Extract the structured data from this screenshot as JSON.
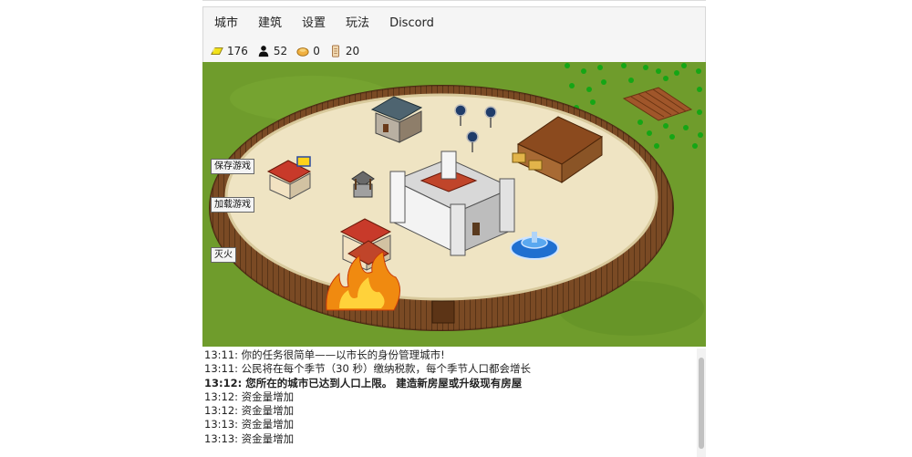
{
  "menu": [
    {
      "label": "城市"
    },
    {
      "label": "建筑"
    },
    {
      "label": "设置"
    },
    {
      "label": "玩法"
    },
    {
      "label": "Discord"
    }
  ],
  "resources": [
    {
      "icon": "gold-icon",
      "value": "176"
    },
    {
      "icon": "population-icon",
      "value": "52"
    },
    {
      "icon": "food-icon",
      "value": "0"
    },
    {
      "icon": "scroll-icon",
      "value": "20"
    }
  ],
  "side_buttons": {
    "save": "保存游戏",
    "load": "加载游戏",
    "extinguish": "灭火"
  },
  "log": [
    {
      "time": "13:11:",
      "text": "你的任务很简单——以市长的身份管理城市!",
      "bold": false
    },
    {
      "time": "13:11:",
      "text": "公民将在每个季节（30 秒）缴纳税款，每个季节人口都会增长",
      "bold": false
    },
    {
      "time": "13:12:",
      "text": " 您所在的城市已达到人口上限。 建造新房屋或升级现有房屋",
      "bold": true
    },
    {
      "time": "13:12:",
      "text": "资金量增加",
      "bold": false
    },
    {
      "time": "13:12:",
      "text": "资金量增加",
      "bold": false
    },
    {
      "time": "13:13:",
      "text": "资金量增加",
      "bold": false
    },
    {
      "time": "13:13:",
      "text": "资金量增加",
      "bold": false
    }
  ],
  "colors": {
    "grass": "#6b9a2a",
    "sand": "#eee4c2",
    "palisade": "#7a4a24",
    "gold": "#e8d21a"
  }
}
